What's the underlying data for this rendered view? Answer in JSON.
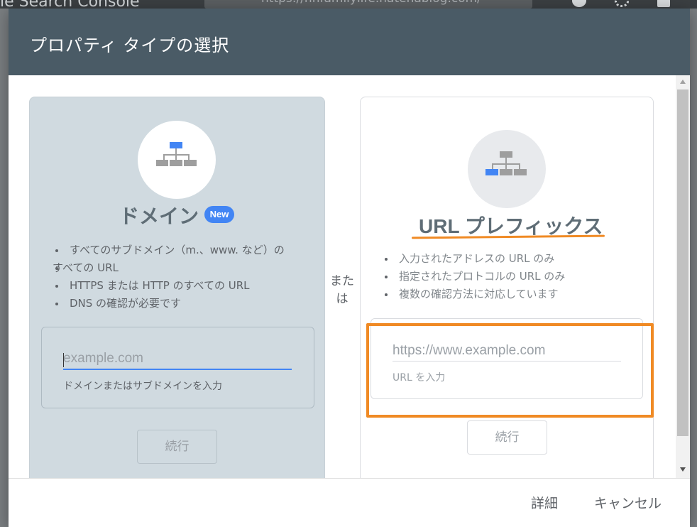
{
  "background": {
    "app_title": "le Search Console",
    "search_text": "https://hhfamilylife.hatenablog.com/"
  },
  "dialog": {
    "title": "プロパティ タイプの選択",
    "or_label": "または",
    "details_label": "詳細",
    "cancel_label": "キャンセル"
  },
  "domain_card": {
    "title": "ドメイン",
    "badge": "New",
    "features": [
      "すべてのサブドメイン（m.、www. など）の",
      "すべての URL",
      "HTTPS または HTTP のすべての URL",
      "DNS の確認が必要です"
    ],
    "input_placeholder": "example.com",
    "helper": "ドメインまたはサブドメインを入力",
    "continue_label": "続行"
  },
  "url_card": {
    "title": "URL プレフィックス",
    "features": [
      "入力されたアドレスの URL のみ",
      "指定されたプロトコルの URL のみ",
      "複数の確認方法に対応しています"
    ],
    "input_placeholder": "https://www.example.com",
    "helper": "URL を入力",
    "continue_label": "続行"
  },
  "colors": {
    "header": "#4a5b66",
    "accent_blue": "#4285f4",
    "highlight_orange": "#f08a24"
  }
}
